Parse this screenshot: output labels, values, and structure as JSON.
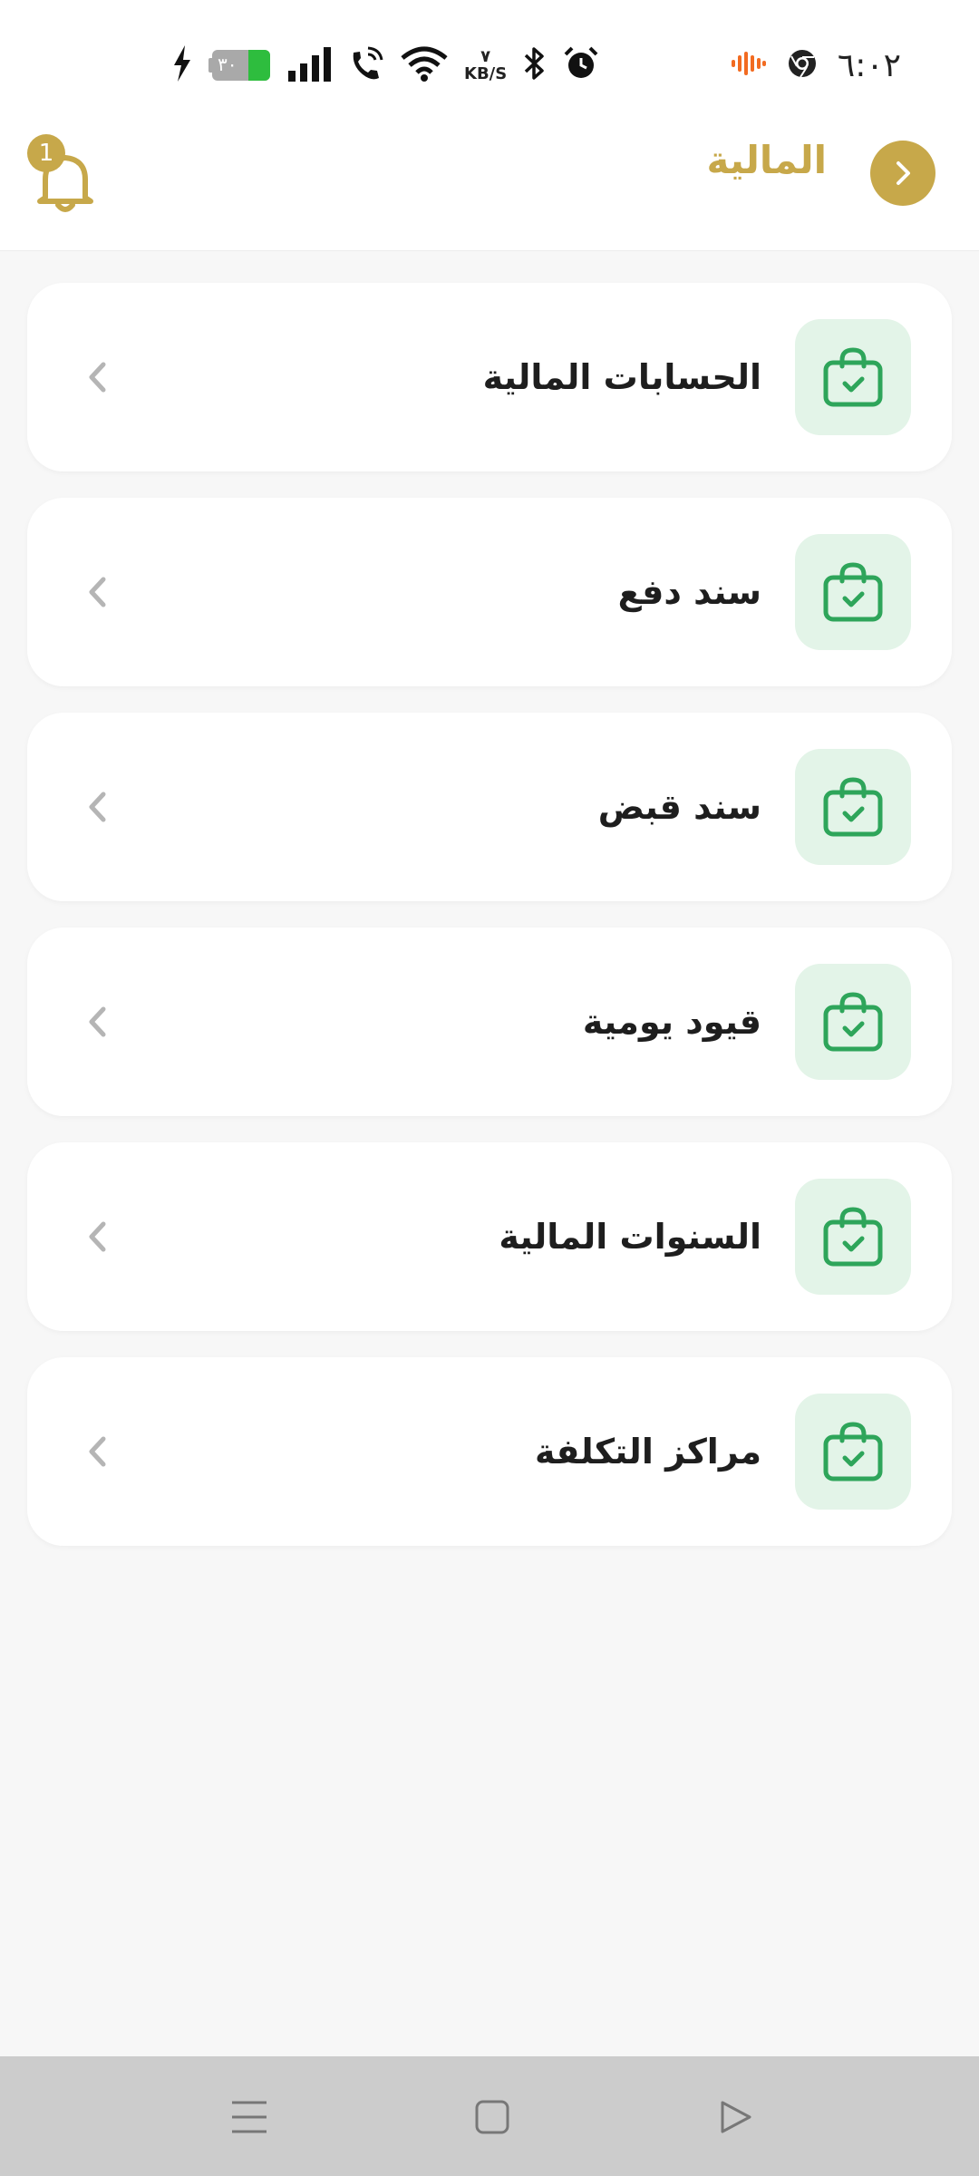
{
  "status_bar": {
    "time": "٦:٠٢",
    "battery_level": "٣٠",
    "net_speed_value": "٧",
    "net_speed_unit": "KB/S",
    "icons": [
      "audio-icon",
      "chrome-icon",
      "alarm-icon",
      "bluetooth-icon",
      "wifi-icon",
      "wifi-call-icon",
      "signal-icon",
      "battery-icon",
      "charging-icon"
    ]
  },
  "header": {
    "title": "المالية",
    "notification_count": "1",
    "accent_color": "#c7a84a"
  },
  "menu": {
    "items": [
      {
        "label": "الحسابات المالية"
      },
      {
        "label": "سند دفع"
      },
      {
        "label": "سند قبض"
      },
      {
        "label": "قيود يومية"
      },
      {
        "label": "السنوات المالية"
      },
      {
        "label": "مراكز التكلفة"
      }
    ],
    "icon_color": "#2ea55a",
    "icon_bg_color": "#e3f4e8"
  },
  "nav_bar": {
    "buttons": [
      "menu-icon",
      "home-icon",
      "back-icon"
    ]
  }
}
